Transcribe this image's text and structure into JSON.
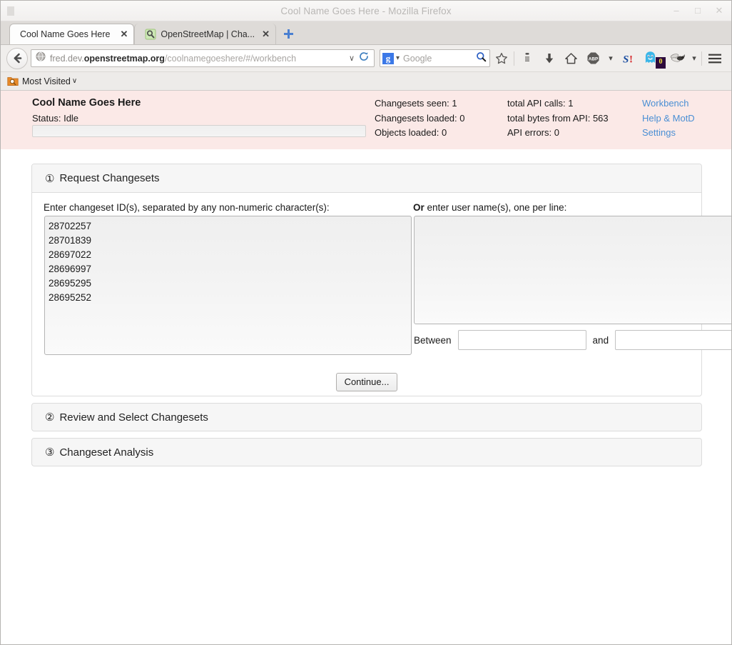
{
  "window": {
    "title": "Cool Name Goes Here - Mozilla Firefox",
    "minimize_label": "–",
    "maximize_label": "□",
    "close_label": "✕"
  },
  "tabs": [
    {
      "label": "Cool Name Goes Here",
      "close_label": "✕",
      "active": true,
      "favicon": "none"
    },
    {
      "label": "OpenStreetMap | Cha...",
      "close_label": "✕",
      "active": false,
      "favicon": "osm-magnifier-icon"
    }
  ],
  "newtab": {
    "label": "+"
  },
  "navbar": {
    "back_label": "←",
    "url_prefix": "fred.dev.",
    "url_domain": "openstreetmap.org",
    "url_path": "/coolnamegoeshere/#/workbench",
    "url_full": "fred.dev.openstreetmap.org/coolnamegoeshere/#/workbench",
    "dropdown_label": "∨",
    "reload_label": "⟳",
    "search_engine": "Google",
    "search_engine_letter": "g",
    "search_placeholder": "Google",
    "icons": [
      "bookmark-star-icon",
      "reader-list-icon",
      "download-arrow-icon",
      "home-icon",
      "adblock-plus-icon",
      "adblock-chevron-icon",
      "stumbleupon-icon",
      "ghostery-icon",
      "ghostery-badge",
      "fly-icon",
      "fly-chevron-icon",
      "menu-hamburger-icon"
    ],
    "ghostery_badge_count": "0",
    "adblock_label": "ABP",
    "stumbleupon_label": "S!"
  },
  "bookmarks": {
    "most_visited_label": "Most Visited",
    "chevron": "∨"
  },
  "app_header": {
    "title": "Cool Name Goes Here",
    "status_label": "Status: Idle",
    "stats_col1": [
      "Changesets seen: 1",
      "Changesets loaded: 0",
      "Objects loaded: 0"
    ],
    "stats_col2": [
      "total API calls: 1",
      "total bytes from API: 563",
      "API errors: 0"
    ],
    "links": [
      "Workbench",
      "Help & MotD",
      "Settings"
    ],
    "background_color": "#fbe9e7",
    "link_color": "#4a8fd4"
  },
  "sections": [
    {
      "number": "①",
      "title": "Request Changesets",
      "expanded": true,
      "fields": {
        "ids_label": "Enter changeset ID(s), separated by any non-numeric character(s):",
        "ids_value": "28702257\n28701839\n28697022\n28696997\n28695295\n28695252",
        "ids_list": [
          "28702257",
          "28701839",
          "28697022",
          "28696997",
          "28695295",
          "28695252"
        ],
        "users_label_bold": "Or",
        "users_label_rest": " enter user name(s), one per line:",
        "users_value": "",
        "between_label": "Between",
        "between_from_value": "",
        "and_label": "and",
        "between_to_value": ""
      },
      "continue_label": "Continue..."
    },
    {
      "number": "②",
      "title": "Review and Select Changesets",
      "expanded": false
    },
    {
      "number": "③",
      "title": "Changeset Analysis",
      "expanded": false
    }
  ]
}
